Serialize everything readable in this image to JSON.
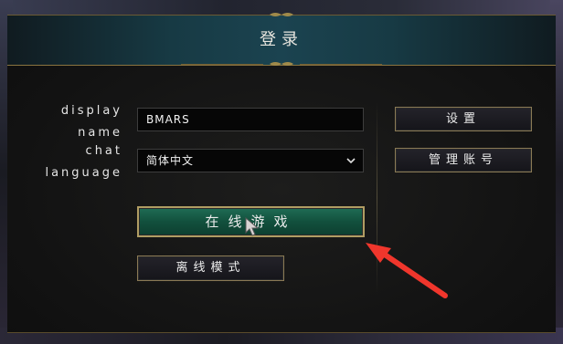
{
  "dialog": {
    "title": "登录"
  },
  "form": {
    "display_name_label": "display\nname",
    "display_name_value": "BMARS",
    "chat_language_label": "chat\nlanguage",
    "chat_language_value": "简体中文"
  },
  "buttons": {
    "settings": "设置",
    "manage_account": "管理账号",
    "play_online": "在线游戏",
    "offline_mode": "离线模式"
  },
  "colors": {
    "header_teal": "#1b4350",
    "play_button_green": "#1f6d55",
    "gold_border": "#b09d63",
    "annotation_arrow": "#f0362c"
  },
  "icons": {
    "select_caret": "chevron-down-icon",
    "mouse_cursor": "cursor-icon",
    "annotation": "red-arrow-icon"
  }
}
